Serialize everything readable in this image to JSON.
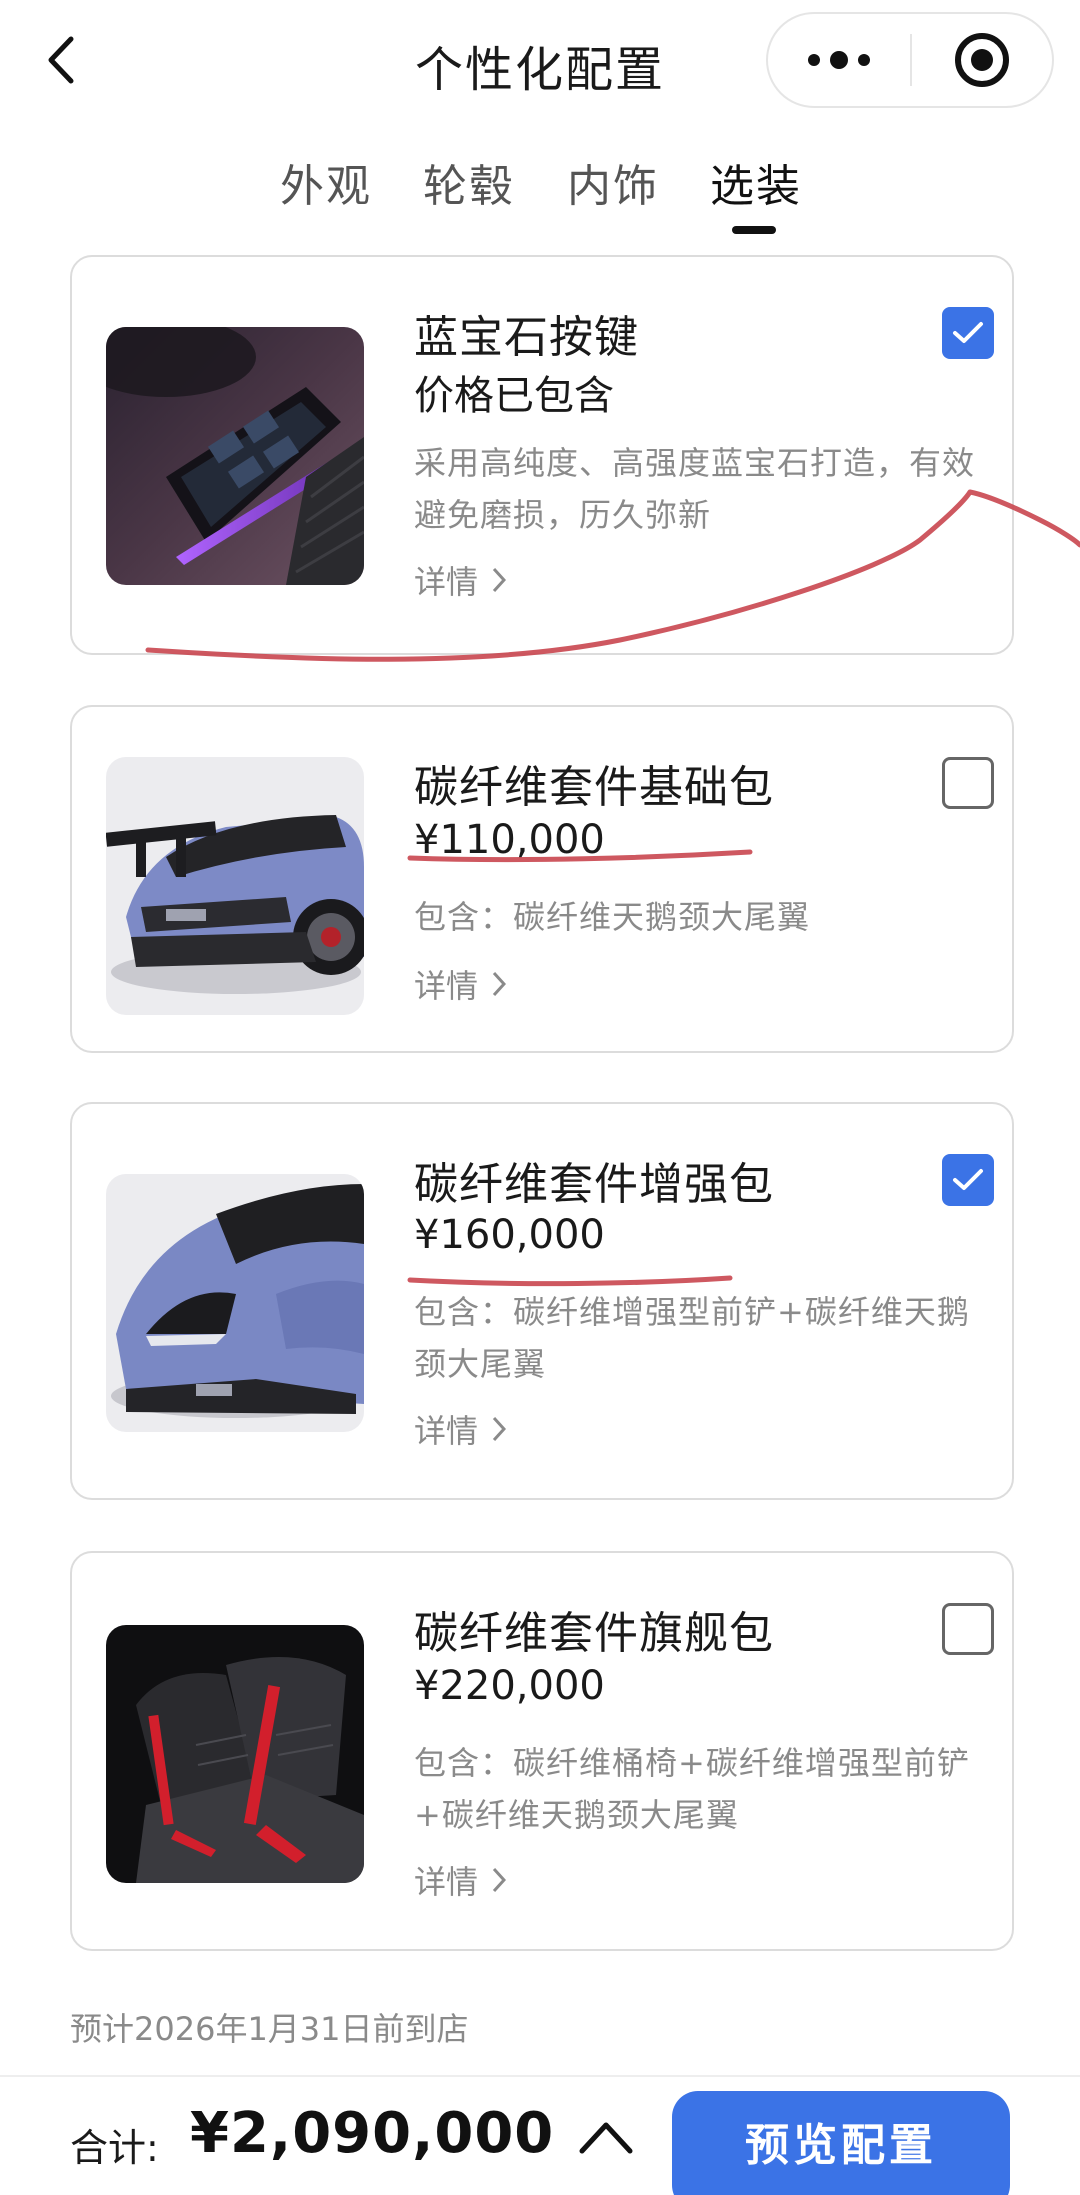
{
  "header": {
    "title": "个性化配置",
    "back_icon": "chevron-left-icon",
    "more_icon": "more-dots-icon",
    "target_icon": "target-icon"
  },
  "tabs": [
    {
      "label": "外观",
      "active": false
    },
    {
      "label": "轮毂",
      "active": false
    },
    {
      "label": "内饰",
      "active": false
    },
    {
      "label": "选装",
      "active": true
    }
  ],
  "options": [
    {
      "title": "蓝宝石按键",
      "price": "价格已包含",
      "desc": "采用高纯度、高强度蓝宝石打造，有效避免磨损，历久弥新",
      "detail": "详情",
      "checked": true
    },
    {
      "title": "碳纤维套件基础包",
      "price": "¥110,000",
      "desc": "包含：碳纤维天鹅颈大尾翼",
      "detail": "详情",
      "checked": false
    },
    {
      "title": "碳纤维套件增强包",
      "price": "¥160,000",
      "desc": "包含：碳纤维增强型前铲+碳纤维天鹅颈大尾翼",
      "detail": "详情",
      "checked": true
    },
    {
      "title": "碳纤维套件旗舰包",
      "price": "¥220,000",
      "desc": "包含：碳纤维桶椅+碳纤维增强型前铲+碳纤维天鹅颈大尾翼",
      "detail": "详情",
      "checked": false
    }
  ],
  "eta": "预计2026年1月31日前到店",
  "footer": {
    "total_label": "合计:",
    "total_value": "¥2,090,000",
    "cta_label": "预览配置"
  },
  "colors": {
    "accent": "#3b73e6",
    "annotation": "#c9464f",
    "muted_text": "#8a8a8a"
  }
}
